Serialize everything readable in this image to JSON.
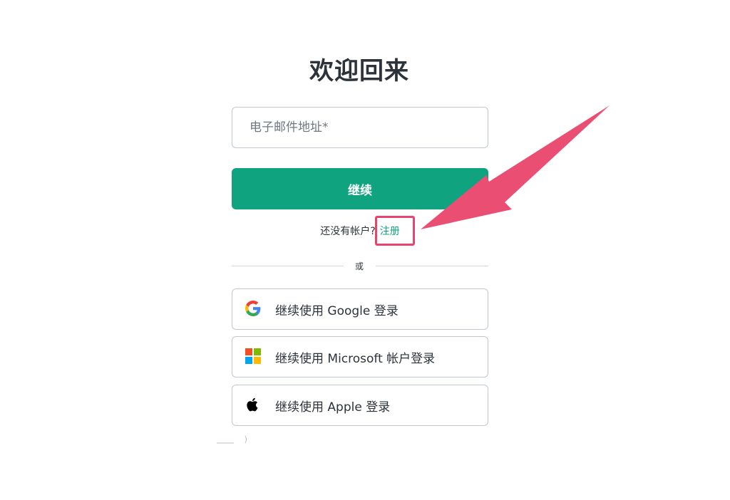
{
  "login": {
    "title": "欢迎回来",
    "email_placeholder": "电子邮件地址*",
    "continue_label": "继续",
    "no_account_text": "还没有帐户?",
    "signup_label": "注册",
    "divider_text": "或",
    "google_label": "继续使用 Google 登录",
    "microsoft_label": "继续使用 Microsoft 帐户登录",
    "apple_label": "继续使用 Apple 登录"
  },
  "icons": {
    "google": "google-icon",
    "microsoft": "microsoft-icon",
    "apple": "apple-icon",
    "arrow": "arrow-annotation"
  },
  "colors": {
    "primary": "#10a37f",
    "annotation": "#e8456e",
    "text": "#2d333a",
    "border": "#c2c8d0"
  }
}
